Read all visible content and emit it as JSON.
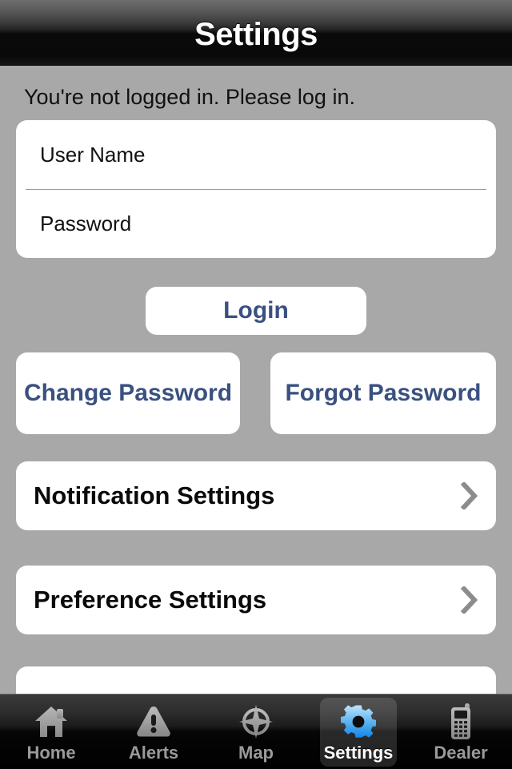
{
  "header": {
    "title": "Settings"
  },
  "main": {
    "status_message": "You're not logged in. Please log in.",
    "fields": [
      {
        "name": "username",
        "placeholder": "User Name",
        "value": ""
      },
      {
        "name": "password",
        "placeholder": "Password",
        "value": ""
      }
    ],
    "buttons": {
      "login": "Login",
      "change_password": "Change Password",
      "forgot_password": "Forgot Password"
    },
    "nav_rows": [
      {
        "label": "Notification Settings",
        "icon": "chevron-right-icon"
      },
      {
        "label": "Preference Settings",
        "icon": "chevron-right-icon"
      }
    ]
  },
  "tabbar": {
    "active": "Settings",
    "tabs": [
      {
        "label": "Home",
        "icon": "home-icon",
        "active": false
      },
      {
        "label": "Alerts",
        "icon": "warning-icon",
        "active": false
      },
      {
        "label": "Map",
        "icon": "compass-icon",
        "active": false
      },
      {
        "label": "Settings",
        "icon": "gear-icon",
        "active": true
      },
      {
        "label": "Dealer",
        "icon": "phone-icon",
        "active": false
      }
    ]
  },
  "colors": {
    "background": "#a8a8a8",
    "card": "#ffffff",
    "accent_blue": "#3a5180",
    "active_tab_icon": "#35a9f4",
    "chevron": "#8c8c8c",
    "tab_label": "#9a9a9a"
  }
}
